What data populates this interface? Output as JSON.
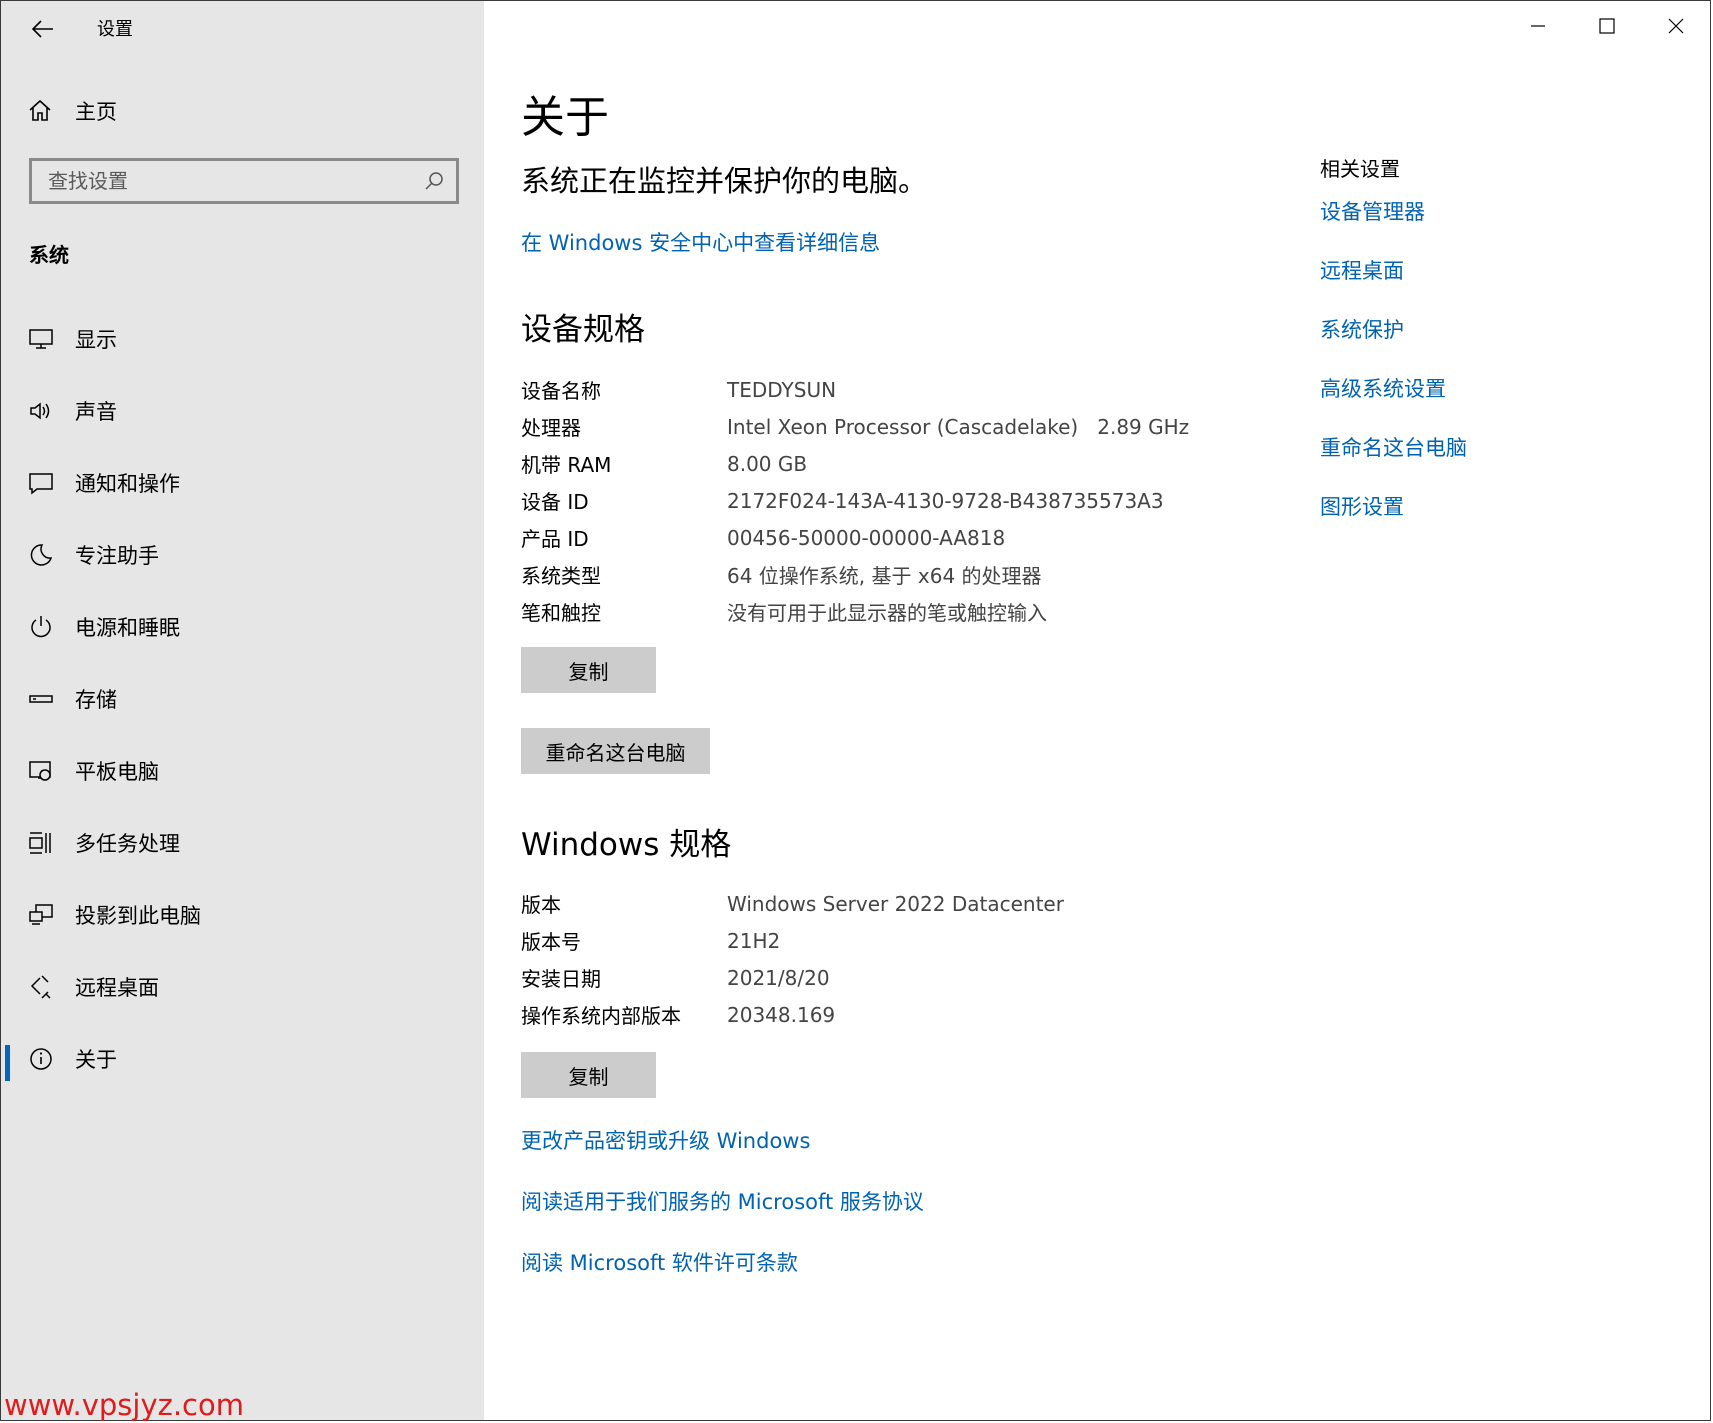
{
  "app": {
    "title": "设置"
  },
  "sidebar": {
    "home_label": "主页",
    "search_placeholder": "查找设置",
    "section_label": "系统",
    "items": [
      {
        "label": "显示",
        "icon": "monitor-icon"
      },
      {
        "label": "声音",
        "icon": "speaker-icon"
      },
      {
        "label": "通知和操作",
        "icon": "notification-icon"
      },
      {
        "label": "专注助手",
        "icon": "moon-icon"
      },
      {
        "label": "电源和睡眠",
        "icon": "power-icon"
      },
      {
        "label": "存储",
        "icon": "storage-icon"
      },
      {
        "label": "平板电脑",
        "icon": "tablet-icon"
      },
      {
        "label": "多任务处理",
        "icon": "multitask-icon"
      },
      {
        "label": "投影到此电脑",
        "icon": "projection-icon"
      },
      {
        "label": "远程桌面",
        "icon": "remote-icon"
      },
      {
        "label": "关于",
        "icon": "info-icon",
        "active": true
      }
    ]
  },
  "main": {
    "title": "关于",
    "status": "系统正在监控并保护你的电脑。",
    "security_link": "在 Windows 安全中心中查看详细信息",
    "device_specs": {
      "heading": "设备规格",
      "rows": [
        {
          "key": "设备名称",
          "value": "TEDDYSUN"
        },
        {
          "key": "处理器",
          "value": "Intel Xeon Processor (Cascadelake)   2.89 GHz"
        },
        {
          "key": "机带 RAM",
          "value": "8.00 GB"
        },
        {
          "key": "设备 ID",
          "value": "2172F024-143A-4130-9728-B438735573A3"
        },
        {
          "key": "产品 ID",
          "value": "00456-50000-00000-AA818"
        },
        {
          "key": "系统类型",
          "value": "64 位操作系统, 基于 x64 的处理器"
        },
        {
          "key": "笔和触控",
          "value": "没有可用于此显示器的笔或触控输入"
        }
      ],
      "copy_label": "复制",
      "rename_label": "重命名这台电脑"
    },
    "windows_specs": {
      "heading": "Windows 规格",
      "rows": [
        {
          "key": "版本",
          "value": "Windows Server 2022 Datacenter"
        },
        {
          "key": "版本号",
          "value": "21H2"
        },
        {
          "key": "安装日期",
          "value": "2021/8/20"
        },
        {
          "key": "操作系统内部版本",
          "value": "20348.169"
        }
      ],
      "copy_label": "复制"
    },
    "bottom_links": [
      "更改产品密钥或升级 Windows",
      "阅读适用于我们服务的 Microsoft 服务协议",
      "阅读 Microsoft 软件许可条款"
    ],
    "related": {
      "heading": "相关设置",
      "links": [
        "设备管理器",
        "远程桌面",
        "系统保护",
        "高级系统设置",
        "重命名这台电脑",
        "图形设置"
      ]
    }
  },
  "watermark": "www.vpsjyz.com",
  "colors": {
    "accent": "#0063b1",
    "sidebar_bg": "#e6e6e6",
    "button_bg": "#cccccc"
  }
}
